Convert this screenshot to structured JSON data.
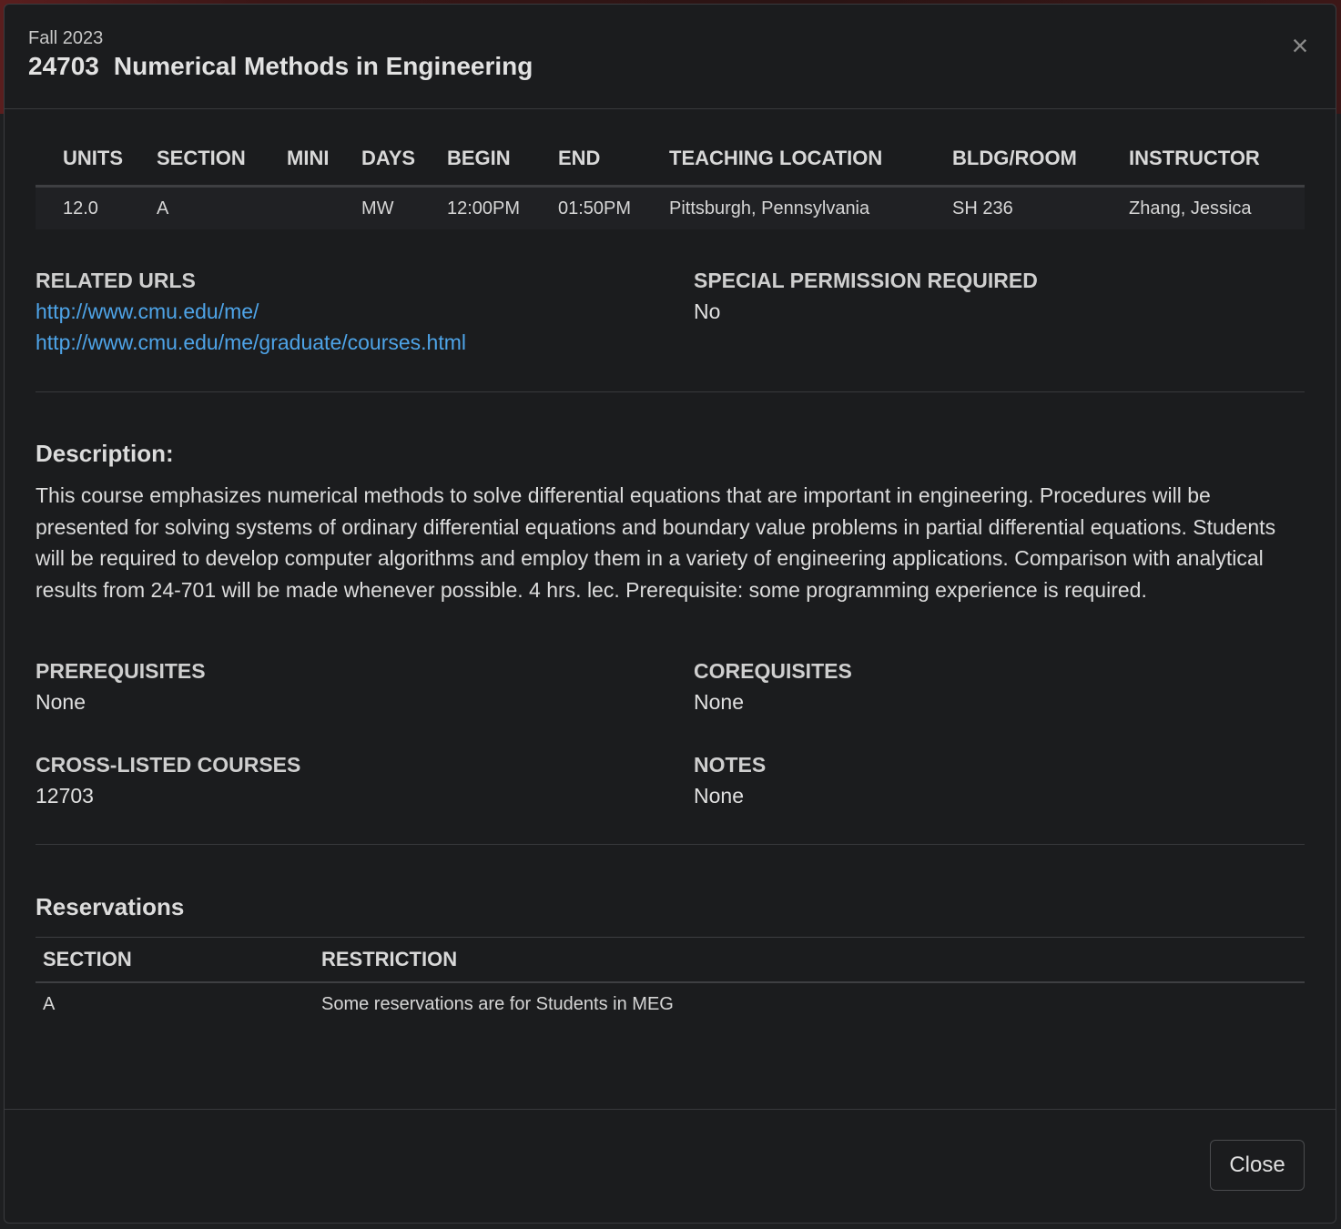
{
  "header": {
    "term": "Fall 2023",
    "course_number": "24703",
    "course_title": "Numerical Methods in Engineering",
    "close_icon": "×"
  },
  "schedule": {
    "headers": [
      "UNITS",
      "SECTION",
      "MINI",
      "DAYS",
      "BEGIN",
      "END",
      "TEACHING LOCATION",
      "BLDG/ROOM",
      "INSTRUCTOR"
    ],
    "rows": [
      [
        "12.0",
        "A",
        "",
        "MW",
        "12:00PM",
        "01:50PM",
        "Pittsburgh, Pennsylvania",
        "SH 236",
        "Zhang, Jessica"
      ]
    ]
  },
  "related_urls": {
    "label": "RELATED URLS",
    "links": [
      "http://www.cmu.edu/me/",
      "http://www.cmu.edu/me/graduate/courses.html"
    ]
  },
  "special_permission": {
    "label": "SPECIAL PERMISSION REQUIRED",
    "value": "No"
  },
  "description": {
    "heading": "Description:",
    "text": "This course emphasizes numerical methods to solve differential equations that are important in engineering. Procedures will be presented for solving systems of ordinary differential equations and boundary value problems in partial differential equations. Students will be required to develop computer algorithms and employ them in a variety of engineering applications. Comparison with analytical results from 24-701 will be made whenever possible. 4 hrs. lec. Prerequisite: some programming experience is required."
  },
  "prerequisites": {
    "label": "PREREQUISITES",
    "value": "None"
  },
  "corequisites": {
    "label": "COREQUISITES",
    "value": "None"
  },
  "cross_listed": {
    "label": "CROSS-LISTED COURSES",
    "value": "12703"
  },
  "notes": {
    "label": "NOTES",
    "value": "None"
  },
  "reservations": {
    "heading": "Reservations",
    "headers": [
      "SECTION",
      "RESTRICTION"
    ],
    "rows": [
      [
        "A",
        "Some reservations are for Students in MEG"
      ]
    ]
  },
  "footer": {
    "close_label": "Close"
  },
  "colors": {
    "link": "#4ea4e8",
    "background": "#1b1c1e"
  }
}
